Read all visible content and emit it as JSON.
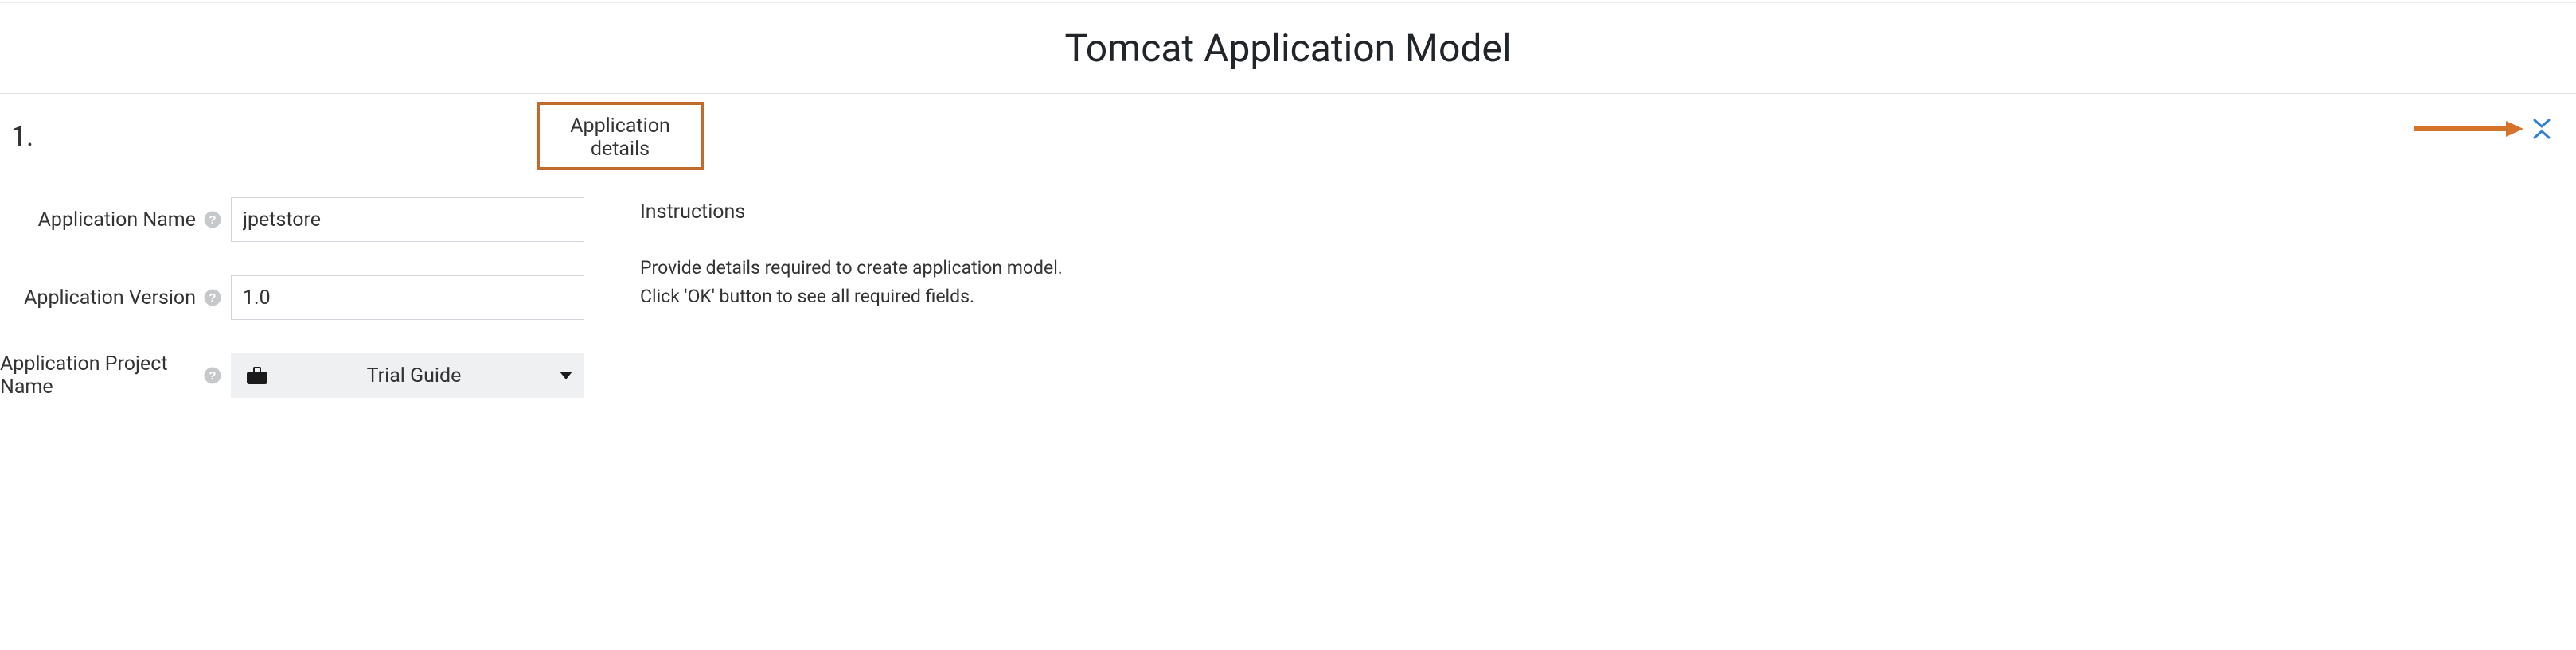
{
  "header": {
    "title": "Tomcat Application Model"
  },
  "section": {
    "step_number": "1.",
    "title": "Application details"
  },
  "form": {
    "app_name": {
      "label": "Application Name",
      "value": "jpetstore"
    },
    "app_version": {
      "label": "Application Version",
      "value": "1.0"
    },
    "app_project": {
      "label": "Application Project Name",
      "selected": "Trial Guide"
    }
  },
  "instructions": {
    "heading": "Instructions",
    "line1": "Provide details required to create application model.",
    "line2": "Click 'OK' button to see all required fields."
  }
}
